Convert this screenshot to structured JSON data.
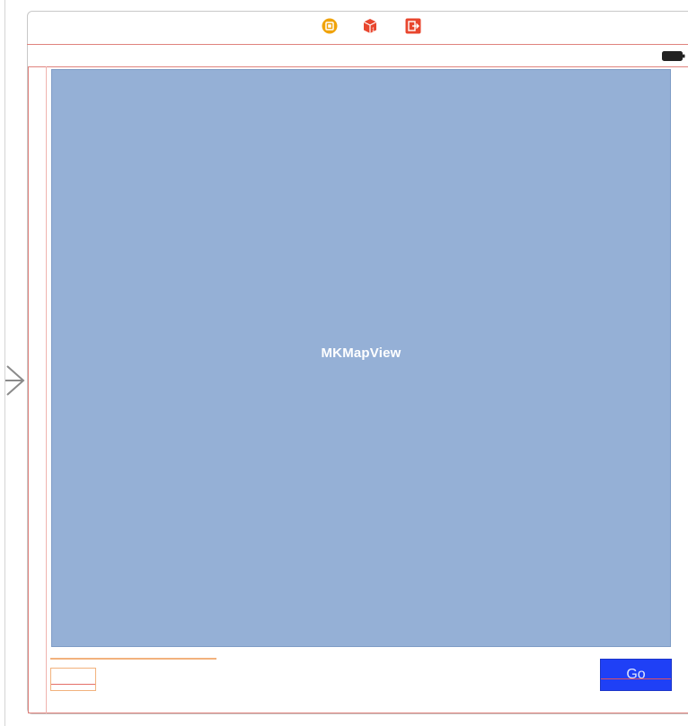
{
  "scene": {
    "dock": {
      "icons": [
        "view-controller-icon",
        "first-responder-icon",
        "exit-icon"
      ]
    },
    "status_bar": {
      "icons": [
        "battery-icon"
      ]
    }
  },
  "map_view": {
    "label": "MKMapView"
  },
  "toolbar": {
    "go_label": "Go"
  },
  "colors": {
    "map_fill": "#95b0d6",
    "go_button": "#1f40f6",
    "constraint_guide": "#e0837d",
    "text_field_guide": "#f2b27d",
    "view_controller_icon": "#f0a30a",
    "cube_icon": "#e8462e",
    "exit_icon": "#e8462e"
  }
}
